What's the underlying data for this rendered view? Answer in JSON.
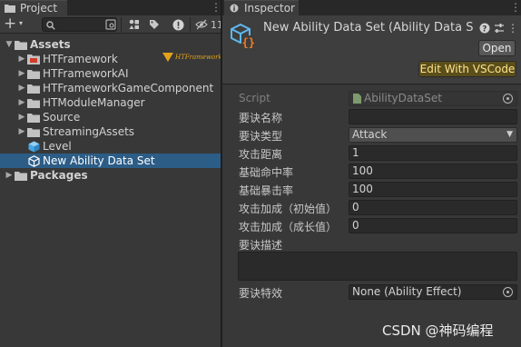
{
  "project": {
    "tab_label": "Project",
    "menu_glyph": "⋮",
    "toolbar": {
      "add_glyph": "+",
      "add_caret": "▾",
      "search_placeholder": "",
      "hidden_count": "11"
    },
    "tree": {
      "expanded_glyph": "▼",
      "collapsed_glyph": "▶",
      "assets_label": "Assets",
      "packages_label": "Packages",
      "items": [
        {
          "label": "HTFramework",
          "icon": "folder-special-icon",
          "badge": "HTFramework"
        },
        {
          "label": "HTFrameworkAI",
          "icon": "folder-icon"
        },
        {
          "label": "HTFrameworkGameComponent",
          "icon": "folder-icon"
        },
        {
          "label": "HTModuleManager",
          "icon": "folder-icon"
        },
        {
          "label": "Source",
          "icon": "folder-icon"
        },
        {
          "label": "StreamingAssets",
          "icon": "folder-icon"
        },
        {
          "label": "Level",
          "icon": "scene-cube-icon"
        },
        {
          "label": "New Ability Data Set",
          "icon": "scriptable-object-icon",
          "selected": true
        }
      ]
    }
  },
  "inspector": {
    "tab_label": "Inspector",
    "menu_glyph": "⋮",
    "asset_title": "New Ability Data Set (Ability Data Set)",
    "open_button": "Open",
    "vscode_button": "Edit With VSCode",
    "script": {
      "label": "Script",
      "value": "AbilityDataSet"
    },
    "fields": [
      {
        "label": "要诀名称",
        "value": "",
        "kind": "text"
      },
      {
        "label": "要诀类型",
        "value": "Attack",
        "kind": "dropdown"
      },
      {
        "label": "攻击距离",
        "value": "1",
        "kind": "text"
      },
      {
        "label": "基础命中率",
        "value": "100",
        "kind": "text"
      },
      {
        "label": "基础暴击率",
        "value": "100",
        "kind": "text"
      },
      {
        "label": "攻击加成（初始值）",
        "value": "0",
        "kind": "text"
      },
      {
        "label": "攻击加成（成长值）",
        "value": "0",
        "kind": "text"
      }
    ],
    "description": {
      "label": "要诀描述",
      "value": ""
    },
    "effect": {
      "label": "要诀特效",
      "value": "None (Ability Effect)"
    },
    "dropdown_caret": "▼"
  },
  "watermark": "CSDN @神码编程",
  "colors": {
    "panel_bg": "#383838",
    "tab_bar_bg": "#282828",
    "selection": "#2c5d87",
    "vscode_button_bg": "#5a4e1b",
    "vscode_button_text": "#ffe38a",
    "asset_icon": "#5fb8f0",
    "asset_icon_braces": "#ff7a1a",
    "htframework_badge": "#e2a21c"
  }
}
